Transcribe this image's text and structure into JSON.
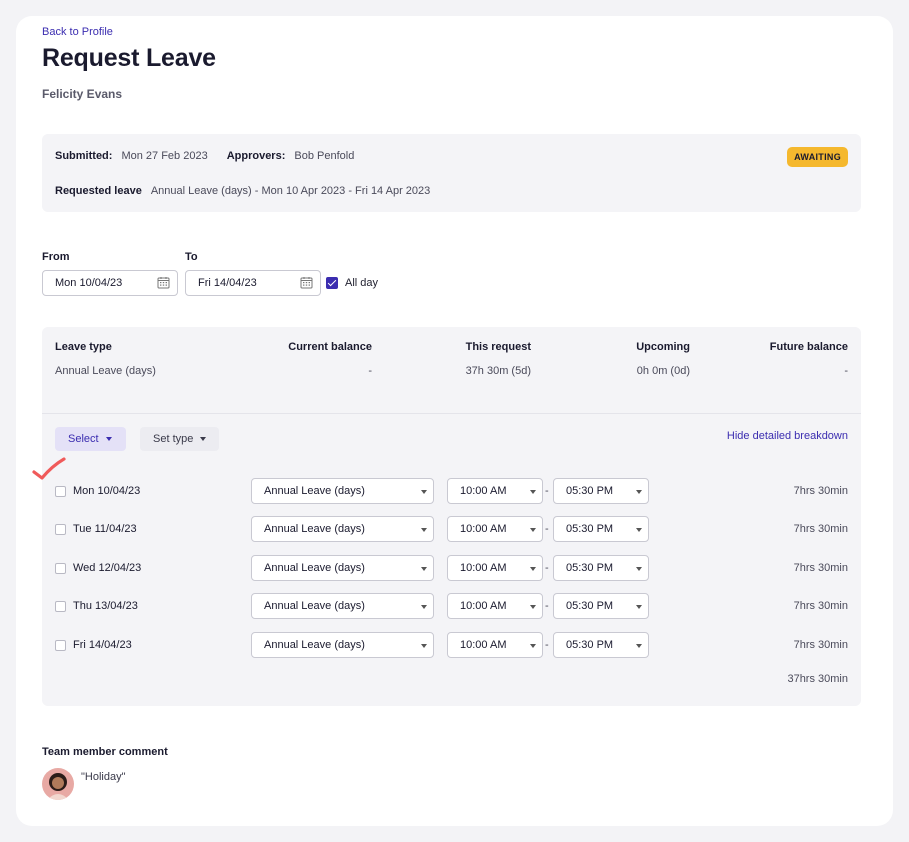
{
  "nav": {
    "back_label": "Back to Profile"
  },
  "header": {
    "title": "Request Leave",
    "person": "Felicity Evans"
  },
  "summary": {
    "submitted_label": "Submitted:",
    "submitted_value": "Mon 27 Feb 2023",
    "approvers_label": "Approvers:",
    "approvers_value": "Bob Penfold",
    "requested_label": "Requested leave",
    "requested_value": "Annual Leave (days) - Mon 10 Apr 2023 - Fri 14 Apr 2023",
    "status": "AWAITING",
    "status_color": "#f5b82e"
  },
  "dates": {
    "from_label": "From",
    "from_value": "Mon 10/04/23",
    "to_label": "To",
    "to_value": "Fri 14/04/23",
    "all_day_label": "All day",
    "all_day_checked": true
  },
  "balance_table": {
    "headers": [
      "Leave type",
      "Current balance",
      "This request",
      "Upcoming",
      "Future balance"
    ],
    "row": [
      "Annual Leave (days)",
      "-",
      "37h 30m (5d)",
      "0h 0m (0d)",
      "-"
    ]
  },
  "controls": {
    "select_label": "Select",
    "set_type_label": "Set type",
    "hide_breakdown_label": "Hide detailed breakdown"
  },
  "days": [
    {
      "date": "Mon 10/04/23",
      "type": "Annual Leave (days)",
      "start": "10:00 AM",
      "end": "05:30 PM",
      "hours": "7hrs 30min"
    },
    {
      "date": "Tue 11/04/23",
      "type": "Annual Leave (days)",
      "start": "10:00 AM",
      "end": "05:30 PM",
      "hours": "7hrs 30min"
    },
    {
      "date": "Wed 12/04/23",
      "type": "Annual Leave (days)",
      "start": "10:00 AM",
      "end": "05:30 PM",
      "hours": "7hrs 30min"
    },
    {
      "date": "Thu 13/04/23",
      "type": "Annual Leave (days)",
      "start": "10:00 AM",
      "end": "05:30 PM",
      "hours": "7hrs 30min"
    },
    {
      "date": "Fri 14/04/23",
      "type": "Annual Leave (days)",
      "start": "10:00 AM",
      "end": "05:30 PM",
      "hours": "7hrs 30min"
    }
  ],
  "total_hours": "37hrs 30min",
  "time_separator": "-",
  "comment": {
    "label": "Team member comment",
    "text": "\"Holiday\""
  },
  "colors": {
    "accent": "#3b2db0",
    "annotation": "#f05a5a"
  },
  "icons": {
    "date_picker": "calendar-icon",
    "dropdown": "chevron-down-icon",
    "annotation": "checkmark-icon"
  }
}
